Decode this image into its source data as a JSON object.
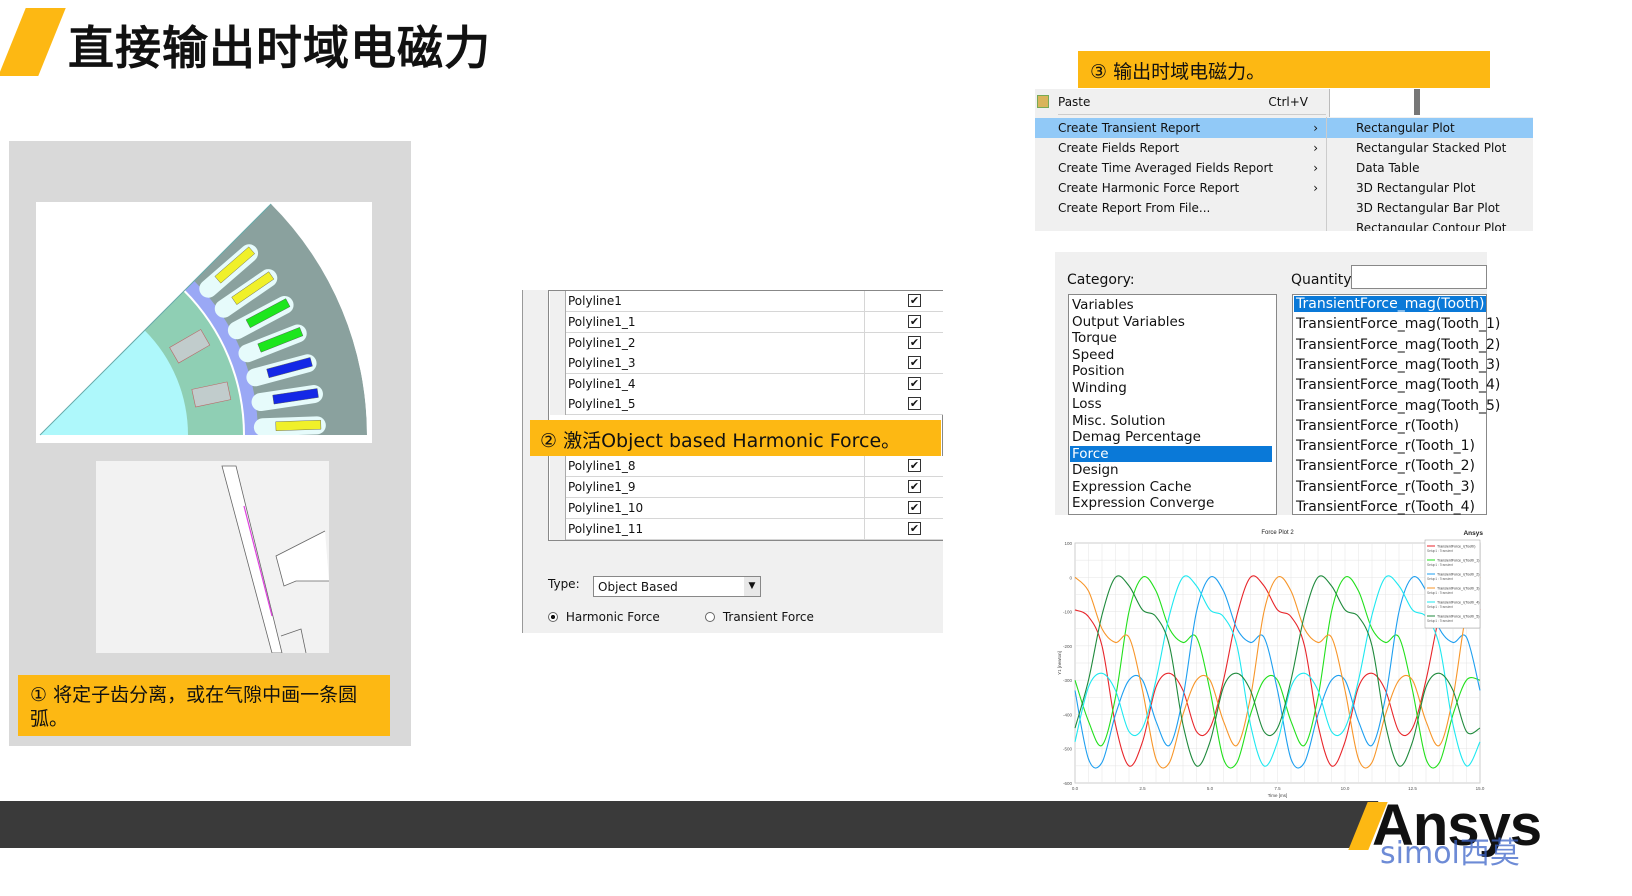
{
  "title": "直接输出时域电磁力",
  "steps": {
    "step1": "① 将定子齿分离，或在气隙中画一条圆弧。",
    "step2": "② 激活Object based Harmonic Force。",
    "step3": "③ 输出时域电磁力。"
  },
  "polyline_table": {
    "rows": [
      {
        "name": "Polyline1",
        "checked": true
      },
      {
        "name": "Polyline1_1",
        "checked": true
      },
      {
        "name": "Polyline1_2",
        "checked": true
      },
      {
        "name": "Polyline1_3",
        "checked": true
      },
      {
        "name": "Polyline1_4",
        "checked": true
      },
      {
        "name": "Polyline1_5",
        "checked": true
      },
      {
        "name": "Polyline1_8",
        "checked": true
      },
      {
        "name": "Polyline1_9",
        "checked": true
      },
      {
        "name": "Polyline1_10",
        "checked": true
      },
      {
        "name": "Polyline1_11",
        "checked": true
      }
    ],
    "check_mark": "✔",
    "type_label": "Type:",
    "type_value": "Object Based",
    "radio_harmonic": "Harmonic Force",
    "radio_transient": "Transient Force",
    "selected_radio": "Harmonic Force"
  },
  "context_menu": {
    "items": [
      {
        "label": "Paste",
        "shortcut": "Ctrl+V"
      },
      {
        "label": "Create Transient Report",
        "submenu": true,
        "highlighted": true
      },
      {
        "label": "Create Fields Report",
        "submenu": true
      },
      {
        "label": "Create Time Averaged Fields Report",
        "submenu": true
      },
      {
        "label": "Create Harmonic Force Report",
        "submenu": true
      },
      {
        "label": "Create Report From File..."
      }
    ],
    "submenu": [
      "Rectangular Plot",
      "Rectangular Stacked Plot",
      "Data Table",
      "3D Rectangular Plot",
      "3D Rectangular Bar Plot",
      "Rectangular Contour Plot"
    ],
    "arrow": "›"
  },
  "report_dialog": {
    "category_label": "Category:",
    "quantity_label": "Quantity:",
    "categories": [
      "Variables",
      "Output Variables",
      "Torque",
      "Speed",
      "Position",
      "Winding",
      "Loss",
      "Misc. Solution",
      "Demag Percentage",
      "Force",
      "Design",
      "Expression Cache",
      "Expression Converge"
    ],
    "selected_category": "Force",
    "quantities": [
      "TransientForce_mag(Tooth)",
      "TransientForce_mag(Tooth_1)",
      "TransientForce_mag(Tooth_2)",
      "TransientForce_mag(Tooth_3)",
      "TransientForce_mag(Tooth_4)",
      "TransientForce_mag(Tooth_5)",
      "TransientForce_r(Tooth)",
      "TransientForce_r(Tooth_1)",
      "TransientForce_r(Tooth_2)",
      "TransientForce_r(Tooth_3)",
      "TransientForce_r(Tooth_4)"
    ],
    "selected_quantity": "TransientForce_mag(Tooth)"
  },
  "chart_data": {
    "type": "line",
    "title": "Force Plot 2",
    "brand": "Ansys",
    "xlabel": "Time [ms]",
    "ylabel": "Y1 [newton]",
    "xlim": [
      0,
      15
    ],
    "ylim": [
      -600,
      100
    ],
    "xticks": [
      "0.0",
      "2.5",
      "5.0",
      "7.5",
      "10.0",
      "12.5",
      "15.0"
    ],
    "yticks": [
      "100",
      "0",
      "-100",
      "-200",
      "-300",
      "-400",
      "-500",
      "-600"
    ],
    "grid": true,
    "legend_position": "top-right",
    "legend_subtitle": "Setup1 : Transient",
    "x": [
      0,
      0.5,
      1,
      1.5,
      2,
      2.5,
      3,
      3.5,
      4,
      4.5,
      5,
      5.5,
      6,
      6.5,
      7,
      7.5,
      8,
      8.5,
      9,
      9.5,
      10,
      10.5,
      11,
      11.5,
      12,
      12.5,
      13,
      13.5,
      14,
      14.5,
      15
    ],
    "series": [
      {
        "name": "TransientForce_r(Tooth)",
        "color": "#e8262b",
        "values": [
          -95,
          -115,
          -200,
          -430,
          -550,
          -480,
          -320,
          -280,
          -330,
          -450,
          -440,
          -300,
          -110,
          0,
          -25,
          -95,
          -115,
          -200,
          -430,
          -550,
          -480,
          -320,
          -280,
          -330,
          -450,
          -440,
          -300,
          -110,
          0,
          -25,
          -95
        ]
      },
      {
        "name": "TransientForce_r(Tooth_1)",
        "color": "#22e01c",
        "values": [
          -300,
          -420,
          -490,
          -350,
          -100,
          0,
          -40,
          -150,
          -190,
          -175,
          -330,
          -530,
          -540,
          -400,
          -300,
          -300,
          -420,
          -490,
          -350,
          -100,
          0,
          -40,
          -150,
          -190,
          -175,
          -330,
          -530,
          -540,
          -400,
          -300,
          -300
        ]
      },
      {
        "name": "TransientForce_r(Tooth_2)",
        "color": "#1e9ff0",
        "values": [
          -330,
          -530,
          -540,
          -400,
          -300,
          -300,
          -420,
          -490,
          -350,
          -100,
          0,
          -40,
          -150,
          -190,
          -175,
          -330,
          -530,
          -540,
          -400,
          -300,
          -300,
          -420,
          -490,
          -350,
          -100,
          0,
          -40,
          -150,
          -190,
          -175,
          -330
        ]
      },
      {
        "name": "TransientForce_r(Tooth_3)",
        "color": "#f7962a",
        "values": [
          0,
          -40,
          -150,
          -190,
          -175,
          -330,
          -530,
          -540,
          -400,
          -300,
          -300,
          -420,
          -490,
          -350,
          -100,
          0,
          -40,
          -150,
          -190,
          -175,
          -330,
          -530,
          -540,
          -400,
          -300,
          -300,
          -420,
          -490,
          -350,
          -100,
          0
        ]
      },
      {
        "name": "TransientForce_r(Tooth_4)",
        "color": "#1ee8f0",
        "values": [
          -480,
          -320,
          -280,
          -330,
          -450,
          -440,
          -300,
          -110,
          0,
          -25,
          -95,
          -115,
          -200,
          -430,
          -550,
          -480,
          -320,
          -280,
          -330,
          -450,
          -440,
          -300,
          -110,
          0,
          -25,
          -95,
          -115,
          -200,
          -430,
          -550,
          -480
        ]
      },
      {
        "name": "TransientForce_r(Tooth_5)",
        "color": "#1f8a3c",
        "values": [
          -440,
          -300,
          -110,
          0,
          -25,
          -95,
          -115,
          -200,
          -430,
          -550,
          -480,
          -320,
          -280,
          -330,
          -450,
          -440,
          -300,
          -110,
          0,
          -25,
          -95,
          -115,
          -200,
          -430,
          -550,
          -480,
          -320,
          -280,
          -330,
          -450,
          -440
        ]
      }
    ]
  },
  "footer": {
    "logo": "Ansys",
    "watermark": "simol西莫"
  },
  "colors": {
    "accent": "#fdb813",
    "footer_bar": "#3a3a3a",
    "selection": "#0a79d8",
    "menu_highlight": "#91c9f7"
  }
}
